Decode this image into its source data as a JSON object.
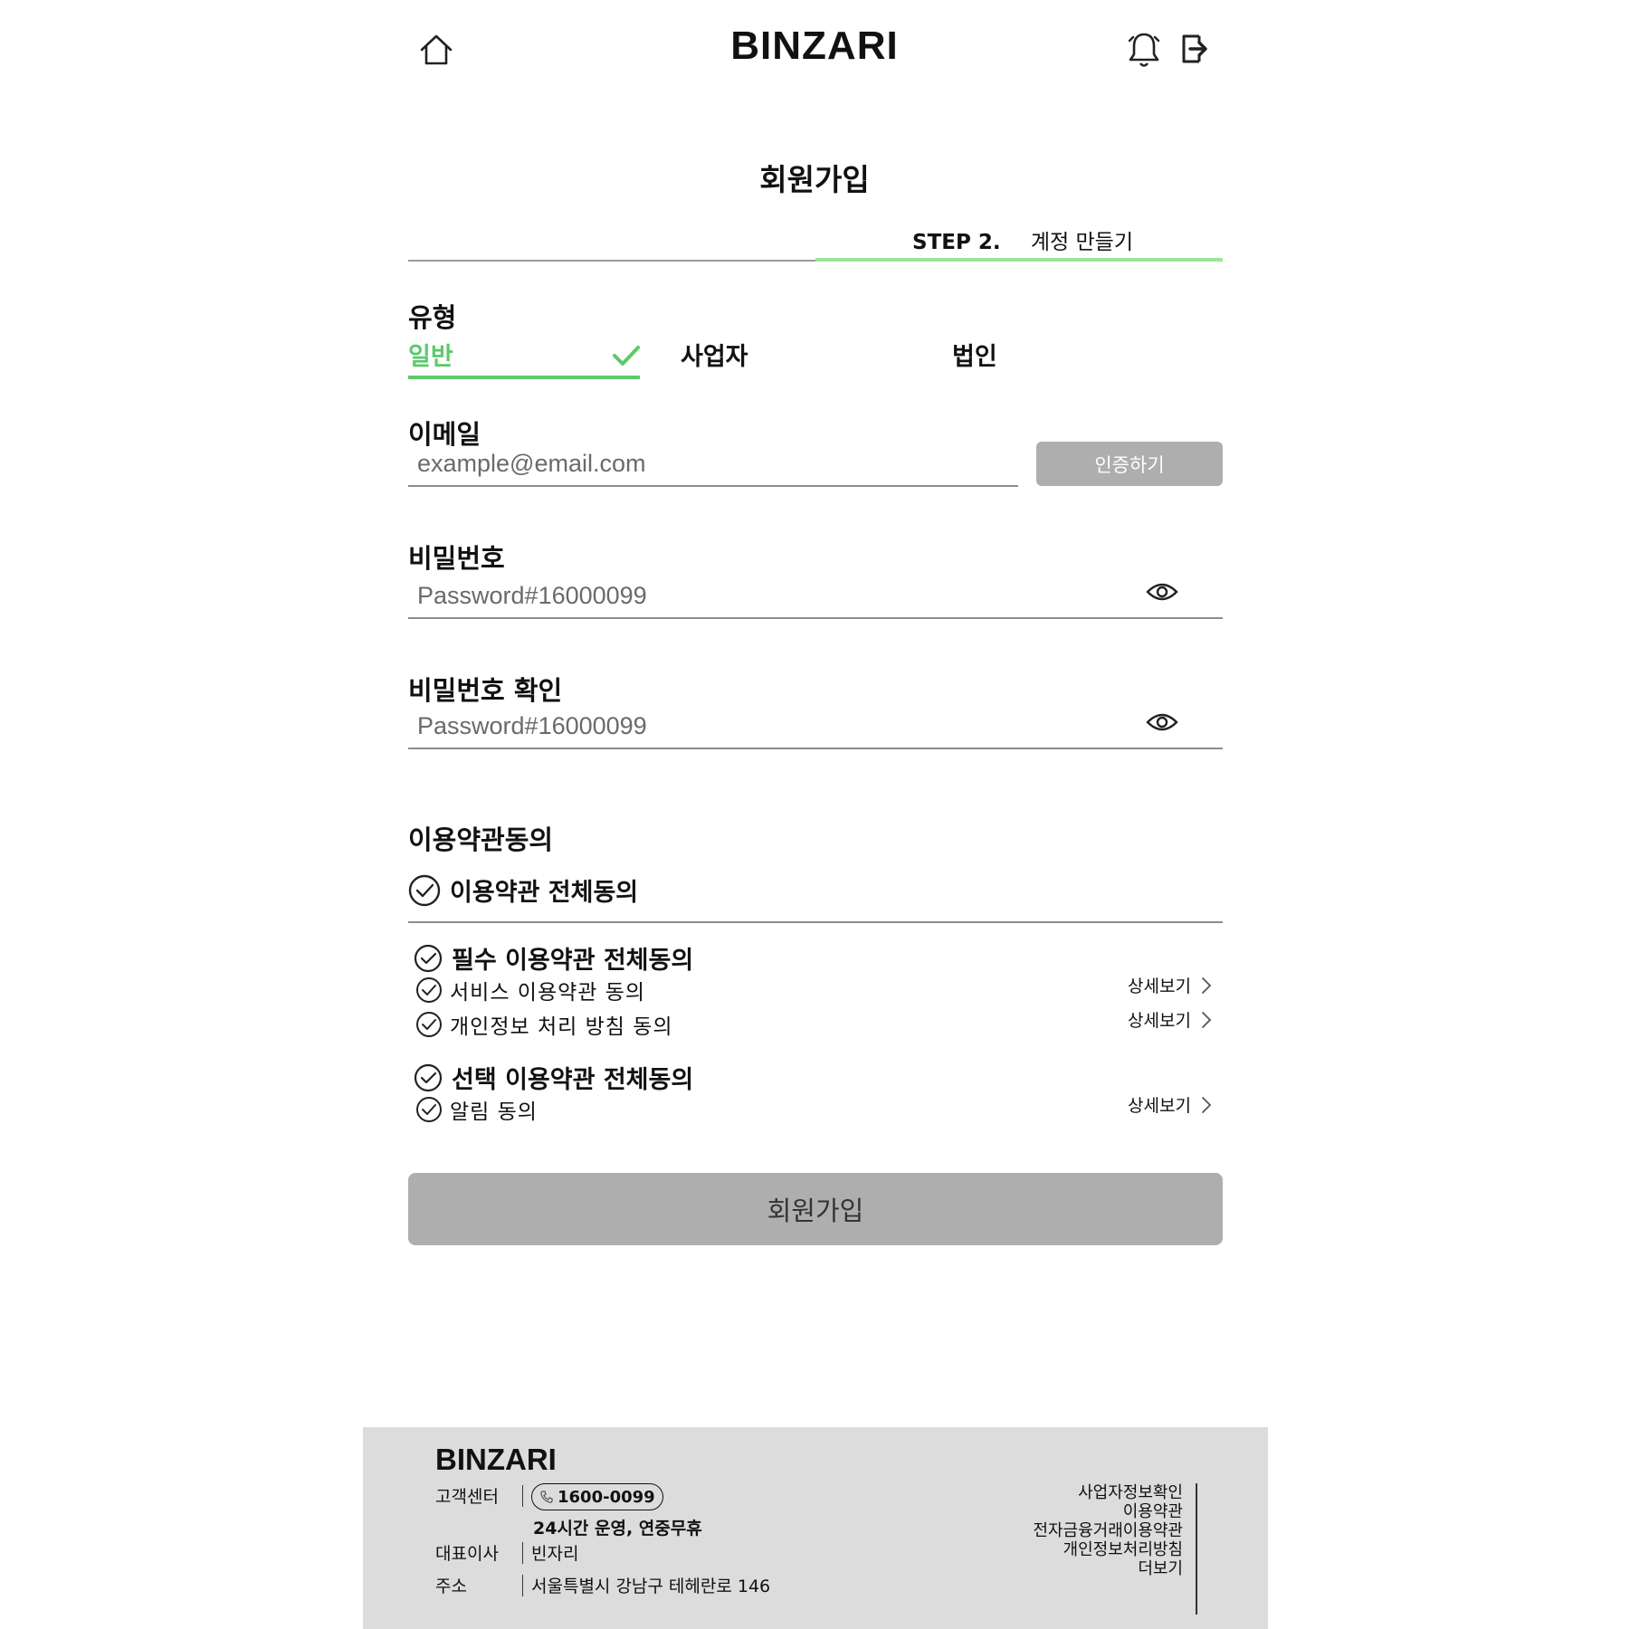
{
  "header": {
    "brand": "BINZARI",
    "home_icon": "home-icon",
    "bell_icon": "bell-icon",
    "logout_icon": "logout-icon"
  },
  "page": {
    "title": "회원가입",
    "step_label": "STEP 2.",
    "step_name": "계정 만들기",
    "accent_color": "#5cc96c",
    "step_progress": 0.5
  },
  "type_section": {
    "label": "유형",
    "tabs": [
      {
        "label": "일반",
        "selected": true
      },
      {
        "label": "사업자",
        "selected": false
      },
      {
        "label": "법인",
        "selected": false
      }
    ]
  },
  "email": {
    "label": "이메일",
    "placeholder": "example@email.com",
    "verify_label": "인증하기"
  },
  "password": {
    "label": "비밀번호",
    "placeholder": "Password#16000099"
  },
  "password_confirm": {
    "label": "비밀번호 확인",
    "placeholder": "Password#16000099"
  },
  "terms": {
    "section_label": "이용약관동의",
    "all_agree": "이용약관 전체동의",
    "required_all": "필수 이용약관 전체동의",
    "service_terms": "서비스 이용약관 동의",
    "privacy_terms": "개인정보 처리 방침 동의",
    "optional_all": "선택 이용약관 전체동의",
    "notification": "알림 동의",
    "detail_label": "상세보기"
  },
  "submit_label": "회원가입",
  "footer": {
    "brand": "BINZARI",
    "cs_key": "고객센터",
    "phone": "1600-0099",
    "hours": "24시간 운영, 연중무휴",
    "ceo_key": "대표이사",
    "ceo_val": "빈자리",
    "addr_key": "주소",
    "addr_val": "서울특별시 강남구 테헤란로 146",
    "links": [
      "사업자정보확인",
      "이용약관",
      "전자금융거래이용약관",
      "개인정보처리방침",
      "더보기"
    ]
  }
}
